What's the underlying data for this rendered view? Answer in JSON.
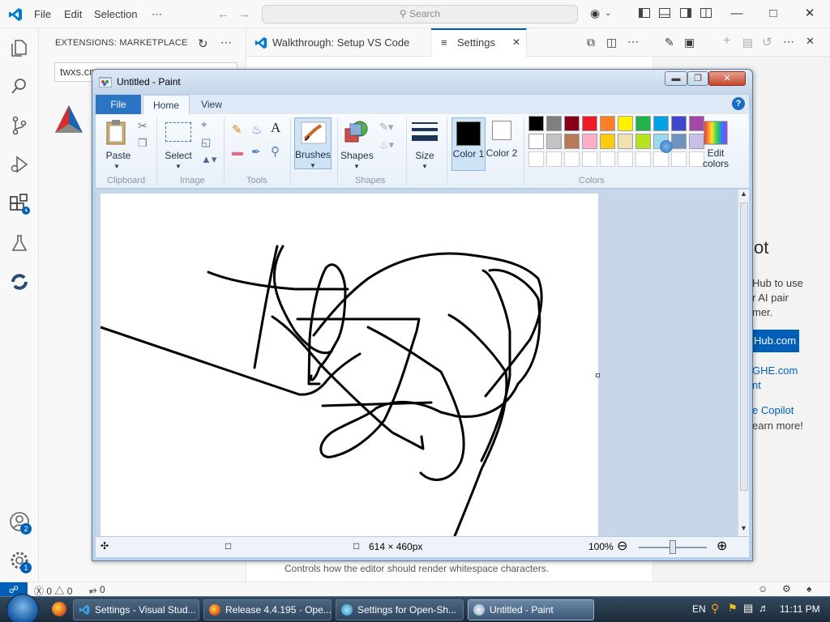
{
  "vscode": {
    "menu": [
      "File",
      "Edit",
      "Selection",
      "⋯"
    ],
    "search_placeholder": "Search",
    "sidebar_title": "EXTENSIONS: MARKETPLACE",
    "sidebar_search_value": "twxs.cm",
    "tabs": [
      {
        "label": "Walkthrough: Setup VS Code"
      },
      {
        "label": "Settings"
      }
    ],
    "welcome": {
      "heading": "ot",
      "text_lines": [
        "Hub to use",
        "r AI pair",
        "mer."
      ],
      "button": "Hub.com",
      "link1": "GHE.com",
      "link2": "nt",
      "copilot_link": "e Copilot",
      "learn_more": "earn more!"
    },
    "editor_caption": "Controls how the editor should render whitespace characters.",
    "status": {
      "errors": "0",
      "warnings": "0",
      "ports": "0"
    },
    "badges": {
      "accounts": "2",
      "manage": "1"
    }
  },
  "paint": {
    "title": "Untitled - Paint",
    "tabs": [
      "File",
      "Home",
      "View"
    ],
    "groups": [
      "Clipboard",
      "Image",
      "Tools",
      "Shapes",
      "Colors"
    ],
    "buttons": {
      "paste": "Paste",
      "select": "Select",
      "brushes": "Brushes",
      "shapes": "Shapes",
      "size": "Size",
      "color1": "Color 1",
      "color2": "Color 2",
      "edit_colors": "Edit colors"
    },
    "palette": [
      "#000000",
      "#7f7f7f",
      "#880015",
      "#ed1c24",
      "#ff7f27",
      "#fff200",
      "#22b14c",
      "#00a2e8",
      "#3f48cc",
      "#a349a4",
      "#ffffff",
      "#c3c3c3",
      "#b97a57",
      "#ffaec9",
      "#ffc90e",
      "#efe4b0",
      "#b5e61d",
      "#99d9ea",
      "#7092be",
      "#c8bfe7"
    ],
    "status": {
      "dimensions": "614 × 460px",
      "zoom": "100%"
    }
  },
  "taskbar": {
    "items": [
      "Settings - Visual Stud...",
      "Release 4.4.195 · Ope...",
      "Settings for Open-Sh...",
      "Untitled - Paint"
    ],
    "lang": "EN",
    "time": "11:11 PM"
  }
}
